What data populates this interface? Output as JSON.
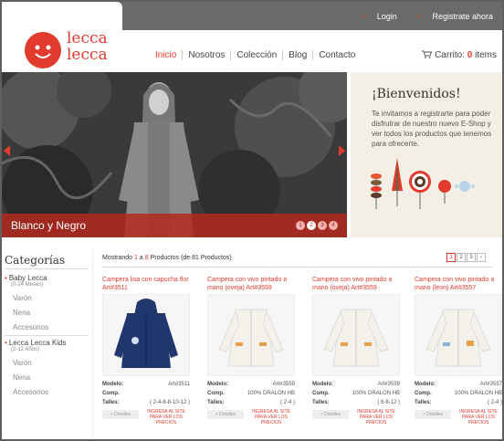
{
  "topbar": {
    "login": "Login",
    "register": "Registrate ahora"
  },
  "logo": {
    "line1": "lecca",
    "line2": "lecca"
  },
  "nav": [
    "Inicio",
    "Nosotros",
    "Colección",
    "Blog",
    "Contacto"
  ],
  "cart": {
    "label": "Carrito:",
    "count": "0",
    "unit": "items"
  },
  "hero": {
    "caption": "Blanco y Negro",
    "slides": [
      "1",
      "2",
      "3",
      "4"
    ],
    "active_slide": 2
  },
  "welcome": {
    "title": "¡Bienvenidos!",
    "text": "Te invitamos a registrarte para poder disfrutrar de nuestro nuevo E-Shop y ver todos los productos que tenemos para ofrecerte."
  },
  "sidebar": {
    "title": "Categorías",
    "categories": [
      {
        "name": "Baby Lecca",
        "sub": "(0-24 Meses)",
        "items": [
          "Varón",
          "Nena",
          "Accesorios"
        ]
      },
      {
        "name": "Lecca Lecca Kids",
        "sub": "(2-12 Años)",
        "items": [
          "Varón",
          "Nena",
          "Accesorios"
        ]
      }
    ]
  },
  "listing": {
    "prefix": "Mostrando",
    "from": "1",
    "a": "a",
    "to": "8",
    "suffix": "Productos (de 81 Productos)",
    "pages": [
      "1",
      "2",
      "3"
    ],
    "next": "›"
  },
  "spec_labels": {
    "modelo": "Modelo:",
    "comp": "Comp.",
    "talles": "Talles:"
  },
  "details_label": "Detalles",
  "register_prompt": "INGRESA AL SITE PARA VER LOS PRECIOS",
  "products": [
    {
      "title": "Campera lisa con capucha flor Art#3511",
      "modelo": "Art#3511",
      "comp": "",
      "talles": "( 2-4-6-8-10-12 )",
      "color": "#22366e"
    },
    {
      "title": "Campera con vivo pintado a mano (oveja) Art#3559",
      "modelo": "Art#3559",
      "comp": "100% DRALON HB",
      "talles": "( 2-4 )",
      "color": "#f4f1ea"
    },
    {
      "title": "Campera con vivo pintado a mano (oveja) Art#3559",
      "modelo": "Art#3559",
      "comp": "100% DRALON HB",
      "talles": "( 6-8-12 )",
      "color": "#f4f1ea"
    },
    {
      "title": "Campera con vivo pintado a mano (leon) Art#3557",
      "modelo": "Art#3557",
      "comp": "100% DRALON HB",
      "talles": "( 2-4 )",
      "color": "#f4f1ea"
    }
  ]
}
